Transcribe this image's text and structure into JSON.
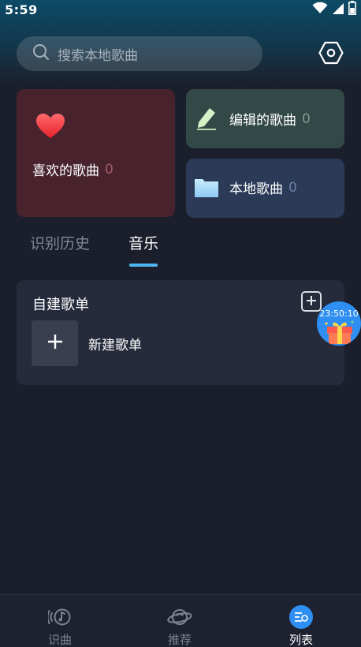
{
  "status_bar": {
    "time": "5:59",
    "icons": [
      "wifi-icon",
      "signal-icon",
      "battery-icon"
    ]
  },
  "search": {
    "placeholder": "搜索本地歌曲",
    "icon": "search-icon"
  },
  "settings": {
    "icon": "hexagon-settings-icon"
  },
  "cards": {
    "favorites": {
      "title": "喜欢的歌曲",
      "count": "0",
      "icon": "heart-icon"
    },
    "edited": {
      "title": "编辑的歌曲",
      "count": "0",
      "icon": "pencil-icon"
    },
    "local": {
      "title": "本地歌曲",
      "count": "0",
      "icon": "folder-icon"
    }
  },
  "tabs": [
    {
      "label": "识别历史",
      "active": false
    },
    {
      "label": "音乐",
      "active": true
    }
  ],
  "playlists": {
    "title": "自建歌单",
    "new_label": "新建歌单"
  },
  "gift_widget": {
    "timer": "23:50:10",
    "icon": "gift-box-icon"
  },
  "bottom_nav": [
    {
      "label": "识曲",
      "icon": "recognize-music-icon",
      "active": false
    },
    {
      "label": "推荐",
      "icon": "planet-icon",
      "active": false
    },
    {
      "label": "列表",
      "icon": "list-icon",
      "active": true
    }
  ],
  "colors": {
    "accent": "#2e8ef1",
    "tab_indicator": "#4fb7f0",
    "background": "#1b1f2b"
  }
}
